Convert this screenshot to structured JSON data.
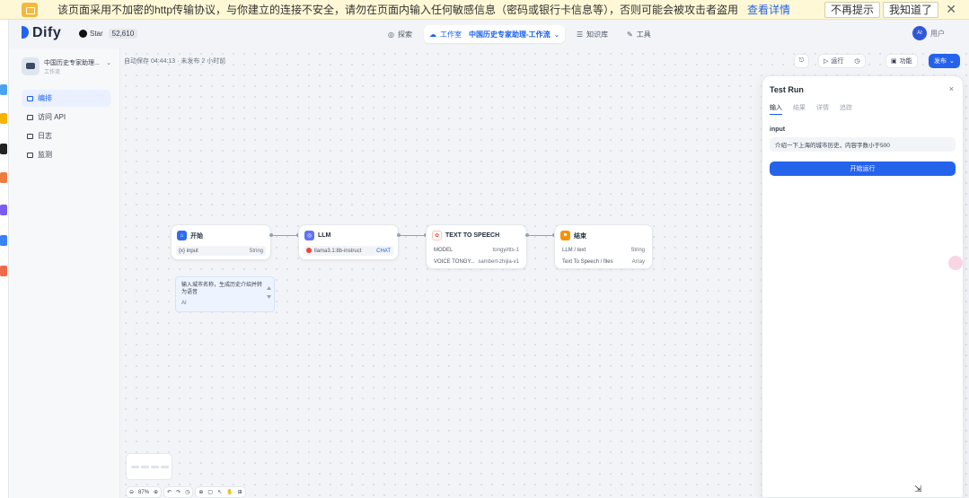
{
  "warning": {
    "text": "该页面采用不加密的http传输协议，与你建立的连接不安全，请勿在页面内输入任何敏感信息（密码或银行卡信息等），否则可能会被攻击者盗用",
    "link": "查看详情",
    "btn_dismiss": "不再提示",
    "btn_ok": "我知道了",
    "close": "✕"
  },
  "nav": {
    "logo": "Dify",
    "github_label": "Star",
    "github_count": "52,610",
    "explore": "探索",
    "studio": "工作室",
    "app_name": "中国历史专家助理-工作流",
    "knowledge": "知识库",
    "tools": "工具",
    "avatar": "AI",
    "user": "用户"
  },
  "sidebar": {
    "app_name": "中国历史专家助理...",
    "app_type": "工作流",
    "items": [
      {
        "label": "编排",
        "active": true
      },
      {
        "label": "访问 API",
        "active": false
      },
      {
        "label": "日志",
        "active": false
      },
      {
        "label": "监测",
        "active": false
      }
    ]
  },
  "canvas": {
    "autosave": "自动保存 04:44:13 · 未发布 2 小时前",
    "btn_run": "运行",
    "btn_features": "功能",
    "btn_publish": "发布"
  },
  "nodes": [
    {
      "title": "开始",
      "color": "#2e6bf0",
      "rows": [
        {
          "left": "{x} input",
          "right": "String"
        }
      ]
    },
    {
      "title": "LLM",
      "color": "#6172f3",
      "rows": [
        {
          "left": "llama3.1:8b-instruct",
          "right": "CHAT"
        }
      ]
    },
    {
      "title": "TEXT TO SPEECH",
      "color": "#f04438",
      "rows": [
        {
          "left": "MODEL",
          "right": "tongyi/tts-1"
        },
        {
          "left": "VOICE TONGY...",
          "right": "sambert-zhijia-v1"
        }
      ]
    },
    {
      "title": "结束",
      "color": "#f79009",
      "rows": [
        {
          "left": "LLM / text",
          "right": "String"
        },
        {
          "left": "Text To Speech / files",
          "right": "Array"
        }
      ]
    }
  ],
  "note": {
    "text": "输入城市名称，生成历史介绍并转为语音",
    "sub": "AI"
  },
  "bottombar": {
    "zoom": "87%"
  },
  "panel": {
    "title": "Test Run",
    "close": "×",
    "tabs": [
      "输入",
      "结果",
      "详情",
      "追踪"
    ],
    "input_label": "input",
    "input_value": "介绍一下上海的城市历史，内容字数小于500",
    "run_button": "开始运行"
  }
}
